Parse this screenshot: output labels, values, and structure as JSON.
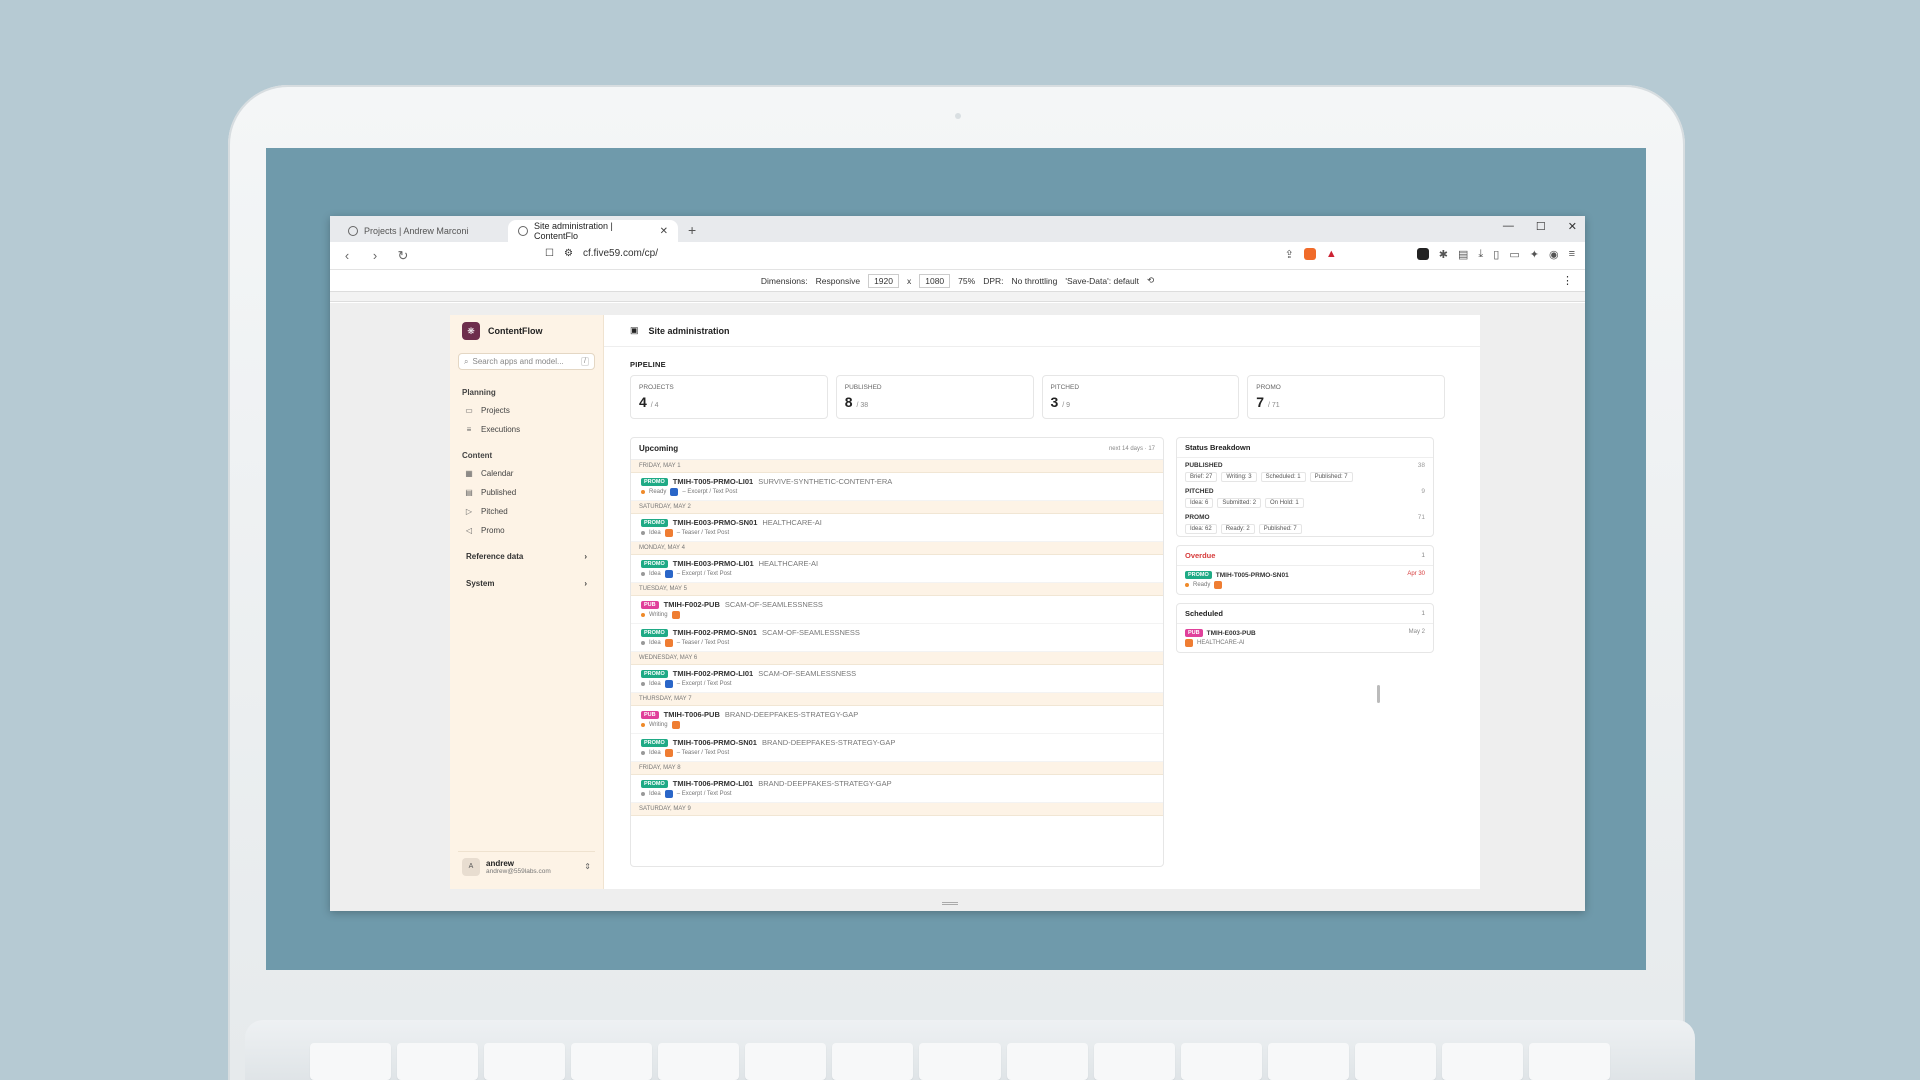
{
  "browser": {
    "tabs": [
      {
        "title": "Projects | Andrew Marconi"
      },
      {
        "title": "Site administration | ContentFlo"
      }
    ],
    "new_tab": "+",
    "url": "cf.five59.com/cp/",
    "window_controls": {
      "minimize": "—",
      "maximize": "☐",
      "close": "✕"
    }
  },
  "devtools": {
    "dimensions_label": "Dimensions:",
    "mode": "Responsive",
    "width": "1920",
    "times": "x",
    "height": "1080",
    "zoom": "75%",
    "dpr_label": "DPR:",
    "throttling": "No throttling",
    "save_data": "'Save-Data': default"
  },
  "sidebar": {
    "brand": "ContentFlow",
    "search_placeholder": "Search apps and model...",
    "search_kbd": "/",
    "sections": [
      {
        "label": "Planning",
        "items": [
          {
            "label": "Projects",
            "icon": "folder-icon"
          },
          {
            "label": "Executions",
            "icon": "list-icon"
          }
        ]
      },
      {
        "label": "Content",
        "items": [
          {
            "label": "Calendar",
            "icon": "calendar-icon"
          },
          {
            "label": "Published",
            "icon": "document-icon"
          },
          {
            "label": "Pitched",
            "icon": "send-icon"
          },
          {
            "label": "Promo",
            "icon": "megaphone-icon"
          }
        ]
      }
    ],
    "collapsibles": [
      {
        "label": "Reference data"
      },
      {
        "label": "System"
      }
    ],
    "user": {
      "initial": "A",
      "name": "andrew",
      "email": "andrew@559labs.com"
    }
  },
  "main": {
    "title": "Site administration",
    "pipeline_label": "PIPELINE",
    "stats": [
      {
        "label": "PROJECTS",
        "value": "4",
        "total": "/ 4"
      },
      {
        "label": "PUBLISHED",
        "value": "8",
        "total": "/ 38"
      },
      {
        "label": "PITCHED",
        "value": "3",
        "total": "/ 9"
      },
      {
        "label": "PROMO",
        "value": "7",
        "total": "/ 71"
      }
    ],
    "upcoming": {
      "title": "Upcoming",
      "meta": "next 14 days · 17",
      "days": [
        {
          "date": "FRIDAY, MAY 1",
          "items": [
            {
              "badge": "PROMO",
              "code": "TMIH-T005-PRMO-LI01",
              "slug": "SURVIVE-SYNTHETIC-CONTENT-ERA",
              "status": "Ready",
              "detail": "– Excerpt / Text Post",
              "plat": "blue"
            }
          ]
        },
        {
          "date": "SATURDAY, MAY 2",
          "items": [
            {
              "badge": "PROMO",
              "code": "TMIH-E003-PRMO-SN01",
              "slug": "HEALTHCARE-AI",
              "status": "Idea",
              "detail": "– Teaser / Text Post",
              "plat": "orange"
            }
          ]
        },
        {
          "date": "MONDAY, MAY 4",
          "items": [
            {
              "badge": "PROMO",
              "code": "TMIH-E003-PRMO-LI01",
              "slug": "HEALTHCARE-AI",
              "status": "Idea",
              "detail": "– Excerpt / Text Post",
              "plat": "blue"
            }
          ]
        },
        {
          "date": "TUESDAY, MAY 5",
          "items": [
            {
              "badge": "PUB",
              "code": "TMIH-F002-PUB",
              "slug": "SCAM-OF-SEAMLESSNESS",
              "status": "Writing",
              "detail": "",
              "plat": "orange"
            },
            {
              "badge": "PROMO",
              "code": "TMIH-F002-PRMO-SN01",
              "slug": "SCAM-OF-SEAMLESSNESS",
              "status": "Idea",
              "detail": "– Teaser / Text Post",
              "plat": "orange"
            }
          ]
        },
        {
          "date": "WEDNESDAY, MAY 6",
          "items": [
            {
              "badge": "PROMO",
              "code": "TMIH-F002-PRMO-LI01",
              "slug": "SCAM-OF-SEAMLESSNESS",
              "status": "Idea",
              "detail": "– Excerpt / Text Post",
              "plat": "blue"
            }
          ]
        },
        {
          "date": "THURSDAY, MAY 7",
          "items": [
            {
              "badge": "PUB",
              "code": "TMIH-T006-PUB",
              "slug": "BRAND-DEEPFAKES-STRATEGY-GAP",
              "status": "Writing",
              "detail": "",
              "plat": "orange"
            },
            {
              "badge": "PROMO",
              "code": "TMIH-T006-PRMO-SN01",
              "slug": "BRAND-DEEPFAKES-STRATEGY-GAP",
              "status": "Idea",
              "detail": "– Teaser / Text Post",
              "plat": "orange"
            }
          ]
        },
        {
          "date": "FRIDAY, MAY 8",
          "items": [
            {
              "badge": "PROMO",
              "code": "TMIH-T006-PRMO-LI01",
              "slug": "BRAND-DEEPFAKES-STRATEGY-GAP",
              "status": "Idea",
              "detail": "– Excerpt / Text Post",
              "plat": "blue"
            }
          ]
        },
        {
          "date": "SATURDAY, MAY 9",
          "items": []
        }
      ]
    },
    "status_breakdown": {
      "title": "Status Breakdown",
      "groups": [
        {
          "title": "PUBLISHED",
          "count": "38",
          "chips": [
            "Brief: 27",
            "Writing: 3",
            "Scheduled: 1",
            "Published: 7"
          ]
        },
        {
          "title": "PITCHED",
          "count": "9",
          "chips": [
            "Idea: 6",
            "Submitted: 2",
            "On Hold: 1"
          ]
        },
        {
          "title": "PROMO",
          "count": "71",
          "chips": [
            "Idea: 62",
            "Ready: 2",
            "Published: 7"
          ]
        }
      ]
    },
    "overdue": {
      "title": "Overdue",
      "count": "1",
      "badge": "PROMO",
      "code": "TMIH-T005-PRMO-SN01",
      "status": "Ready",
      "date": "Apr 30"
    },
    "scheduled": {
      "title": "Scheduled",
      "count": "1",
      "badge": "PUB",
      "code": "TMIH-E003-PUB",
      "slug": "HEALTHCARE-AI",
      "date": "May 2"
    }
  }
}
